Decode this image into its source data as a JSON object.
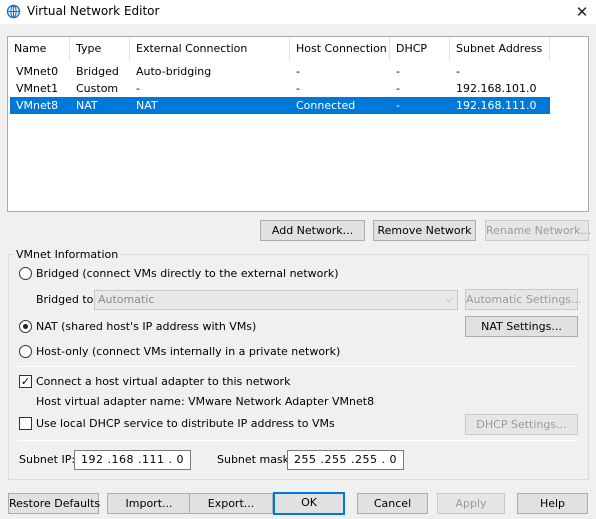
{
  "window": {
    "title": "Virtual Network Editor",
    "close_glyph": "✕"
  },
  "table": {
    "columns": [
      "Name",
      "Type",
      "External Connection",
      "Host Connection",
      "DHCP",
      "Subnet Address"
    ],
    "rows": [
      {
        "name": "VMnet0",
        "type": "Bridged",
        "external": "Auto-bridging",
        "host": "-",
        "dhcp": "-",
        "subnet": "-",
        "selected": false
      },
      {
        "name": "VMnet1",
        "type": "Custom",
        "external": "-",
        "host": "-",
        "dhcp": "-",
        "subnet": "192.168.101.0",
        "selected": false
      },
      {
        "name": "VMnet8",
        "type": "NAT",
        "external": "NAT",
        "host": "Connected",
        "dhcp": "-",
        "subnet": "192.168.111.0",
        "selected": true
      }
    ]
  },
  "table_buttons": {
    "add": "Add Network...",
    "remove": "Remove Network",
    "rename": "Rename Network..."
  },
  "vmnet_info": {
    "group_title": "VMnet Information",
    "bridged_label": "Bridged (connect VMs directly to the external network)",
    "bridged_to_label": "Bridged to:",
    "bridged_to_value": "Automatic",
    "automatic_settings": "Automatic Settings...",
    "nat_label": "NAT (shared host's IP address with VMs)",
    "nat_settings": "NAT Settings...",
    "hostonly_label": "Host-only (connect VMs internally in a private network)",
    "connect_adapter_label": "Connect a host virtual adapter to this network",
    "adapter_name_label": "Host virtual adapter name: VMware Network Adapter VMnet8",
    "dhcp_label": "Use local DHCP service to distribute IP address to VMs",
    "dhcp_settings": "DHCP Settings...",
    "subnet_ip_label": "Subnet IP:",
    "subnet_ip_value": "192 .168 .111 .  0",
    "subnet_mask_label": "Subnet mask:",
    "subnet_mask_value": "255 .255 .255 .  0",
    "selected_mode": "nat",
    "connect_adapter_checked": true,
    "dhcp_checked": false
  },
  "footer_buttons": {
    "restore": "Restore Defaults",
    "import": "Import...",
    "export": "Export...",
    "ok": "OK",
    "cancel": "Cancel",
    "apply": "Apply",
    "help": "Help"
  },
  "icons": {
    "app": "globe-network-icon",
    "close": "close-icon",
    "dropdown": "chevron-down-icon"
  },
  "colors": {
    "selection": "#0078d7",
    "default_button_border": "#0078d7"
  }
}
